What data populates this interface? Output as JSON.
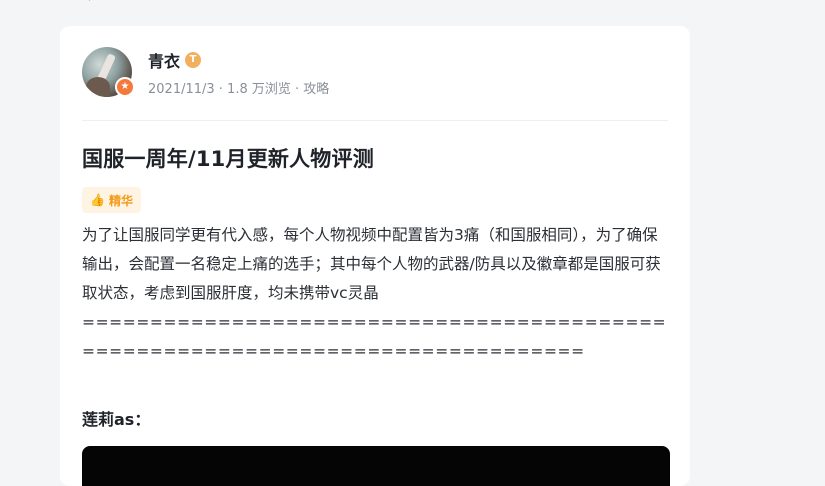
{
  "nav": {
    "back_icon": "arrow-left-icon",
    "back_glyph": "←"
  },
  "author": {
    "name": "青衣",
    "level_badge": "T",
    "verify_icon": "star-badge-icon",
    "verify_glyph": "★",
    "meta": "2021/11/3 · 1.8 万浏览 · 攻略"
  },
  "post": {
    "title": "国服一周年/11月更新人物评测",
    "tag": {
      "icon": "thumbs-up-icon",
      "glyph": "👍",
      "label": "精华"
    },
    "body": "为了让国服同学更有代入感，每个人物视频中配置皆为3痛（和国服相同），为了确保输出，会配置一名稳定上痛的选手；其中每个人物的武器/防具以及徽章都是国服可获取状态，考虑到国服肝度，均未携带vc灵晶",
    "separator": "================================================================================",
    "section_heading": "莲莉as："
  },
  "colors": {
    "accent": "#f29b18",
    "tag_bg": "#fff4e3",
    "badge": "#f4793b"
  }
}
